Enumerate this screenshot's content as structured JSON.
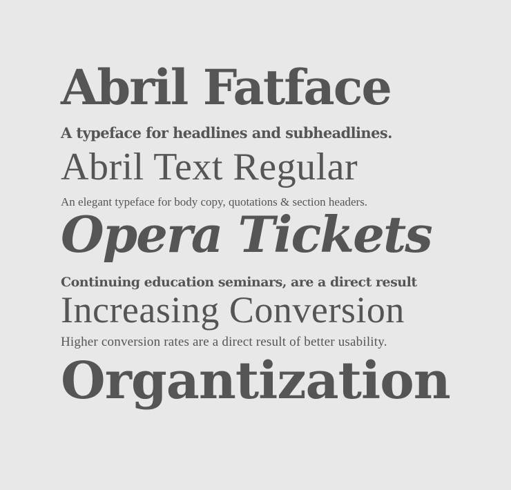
{
  "specimen": {
    "background": "#e8e8e8",
    "text_color": "#555555",
    "lines": [
      "Abril Fatface",
      "A typeface for headlines and subheadlines.",
      "Abril Text Regular",
      "An elegant typeface for body copy, quotations & section headers.",
      "Opera Tickets",
      "Continuing education seminars, are a direct result",
      "Increasing Conversion",
      "Higher conversion rates are a direct result of better usability.",
      "Organtization"
    ]
  }
}
